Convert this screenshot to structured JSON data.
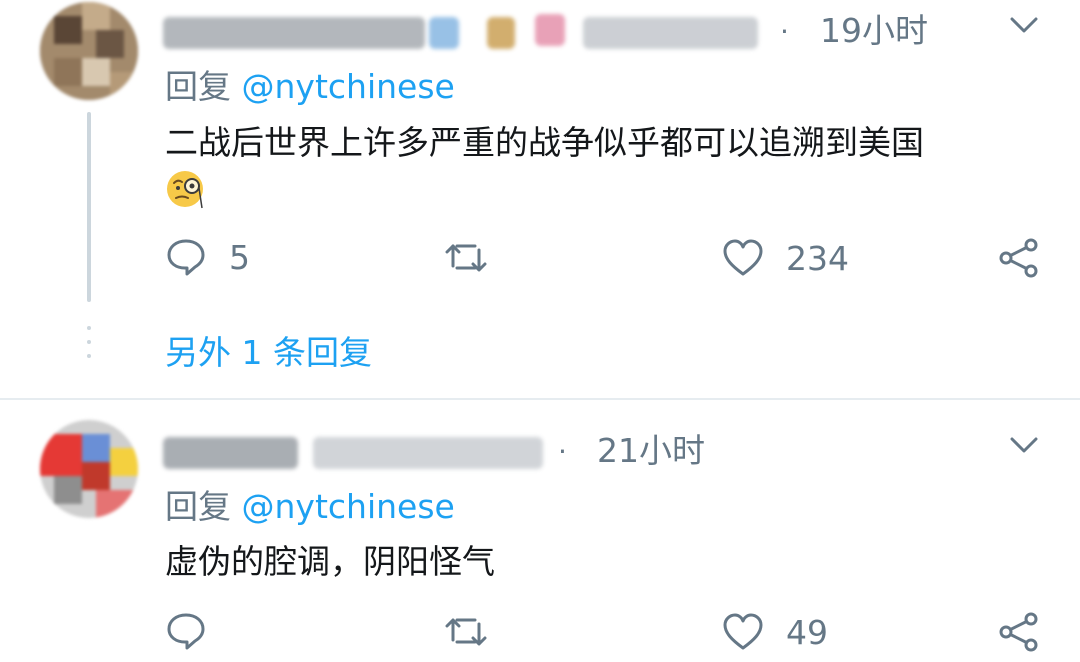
{
  "tweets": [
    {
      "time": "19小时",
      "separator": "·",
      "reply_prefix": "回复",
      "reply_handle": "@nytchinese",
      "text": "二战后世界上许多严重的战争似乎都可以追溯到美国",
      "emoji": "face-with-monocle-icon",
      "reply_count": "5",
      "retweet_count": "",
      "like_count": "234",
      "more_replies": "另外 1 条回复"
    },
    {
      "time": "21小时",
      "separator": "·",
      "reply_prefix": "回复",
      "reply_handle": "@nytchinese",
      "text": "虚伪的腔调，阴阳怪气",
      "reply_count": "",
      "retweet_count": "",
      "like_count": "49"
    }
  ],
  "colors": {
    "accent": "#1da1f2",
    "secondary_text": "#657786",
    "primary_text": "#14171a",
    "divider": "#e6ecf0"
  }
}
